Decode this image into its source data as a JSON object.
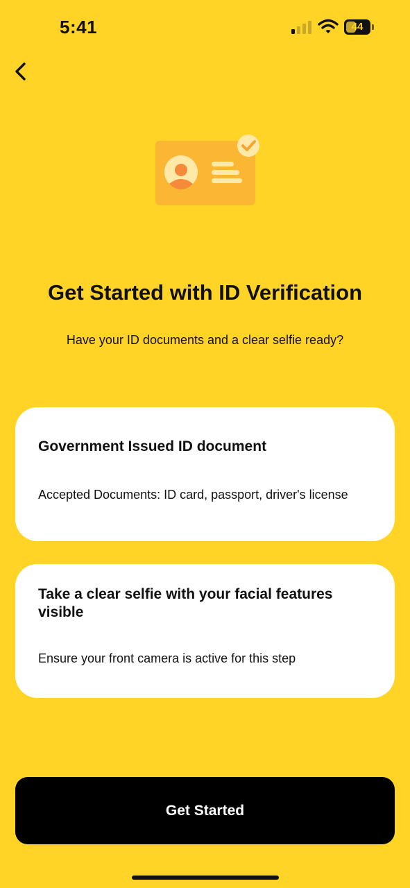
{
  "status_bar": {
    "time": "5:41",
    "battery_level": "44",
    "icons": [
      "signal-icon",
      "wifi-icon",
      "battery-icon"
    ]
  },
  "navigation": {
    "back_icon": "chevron-left-icon"
  },
  "header": {
    "illustration": "id-card-check-icon",
    "title": "Get Started with ID Verification",
    "subtitle": "Have your ID documents and a clear selfie ready?"
  },
  "requirements": [
    {
      "title": "Government Issued ID document",
      "description": "Accepted Documents: ID card, passport, driver's license"
    },
    {
      "title": "Take a clear selfie with your facial features visible",
      "description": "Ensure your front camera is active for this step"
    }
  ],
  "actions": {
    "primary_label": "Get Started"
  },
  "colors": {
    "background": "#FFD426",
    "card": "#FFFFFF",
    "button": "#000000",
    "button_text": "#FFFFFF",
    "illustration_card": "#FBB634",
    "illustration_avatar": "#F58A3A"
  }
}
